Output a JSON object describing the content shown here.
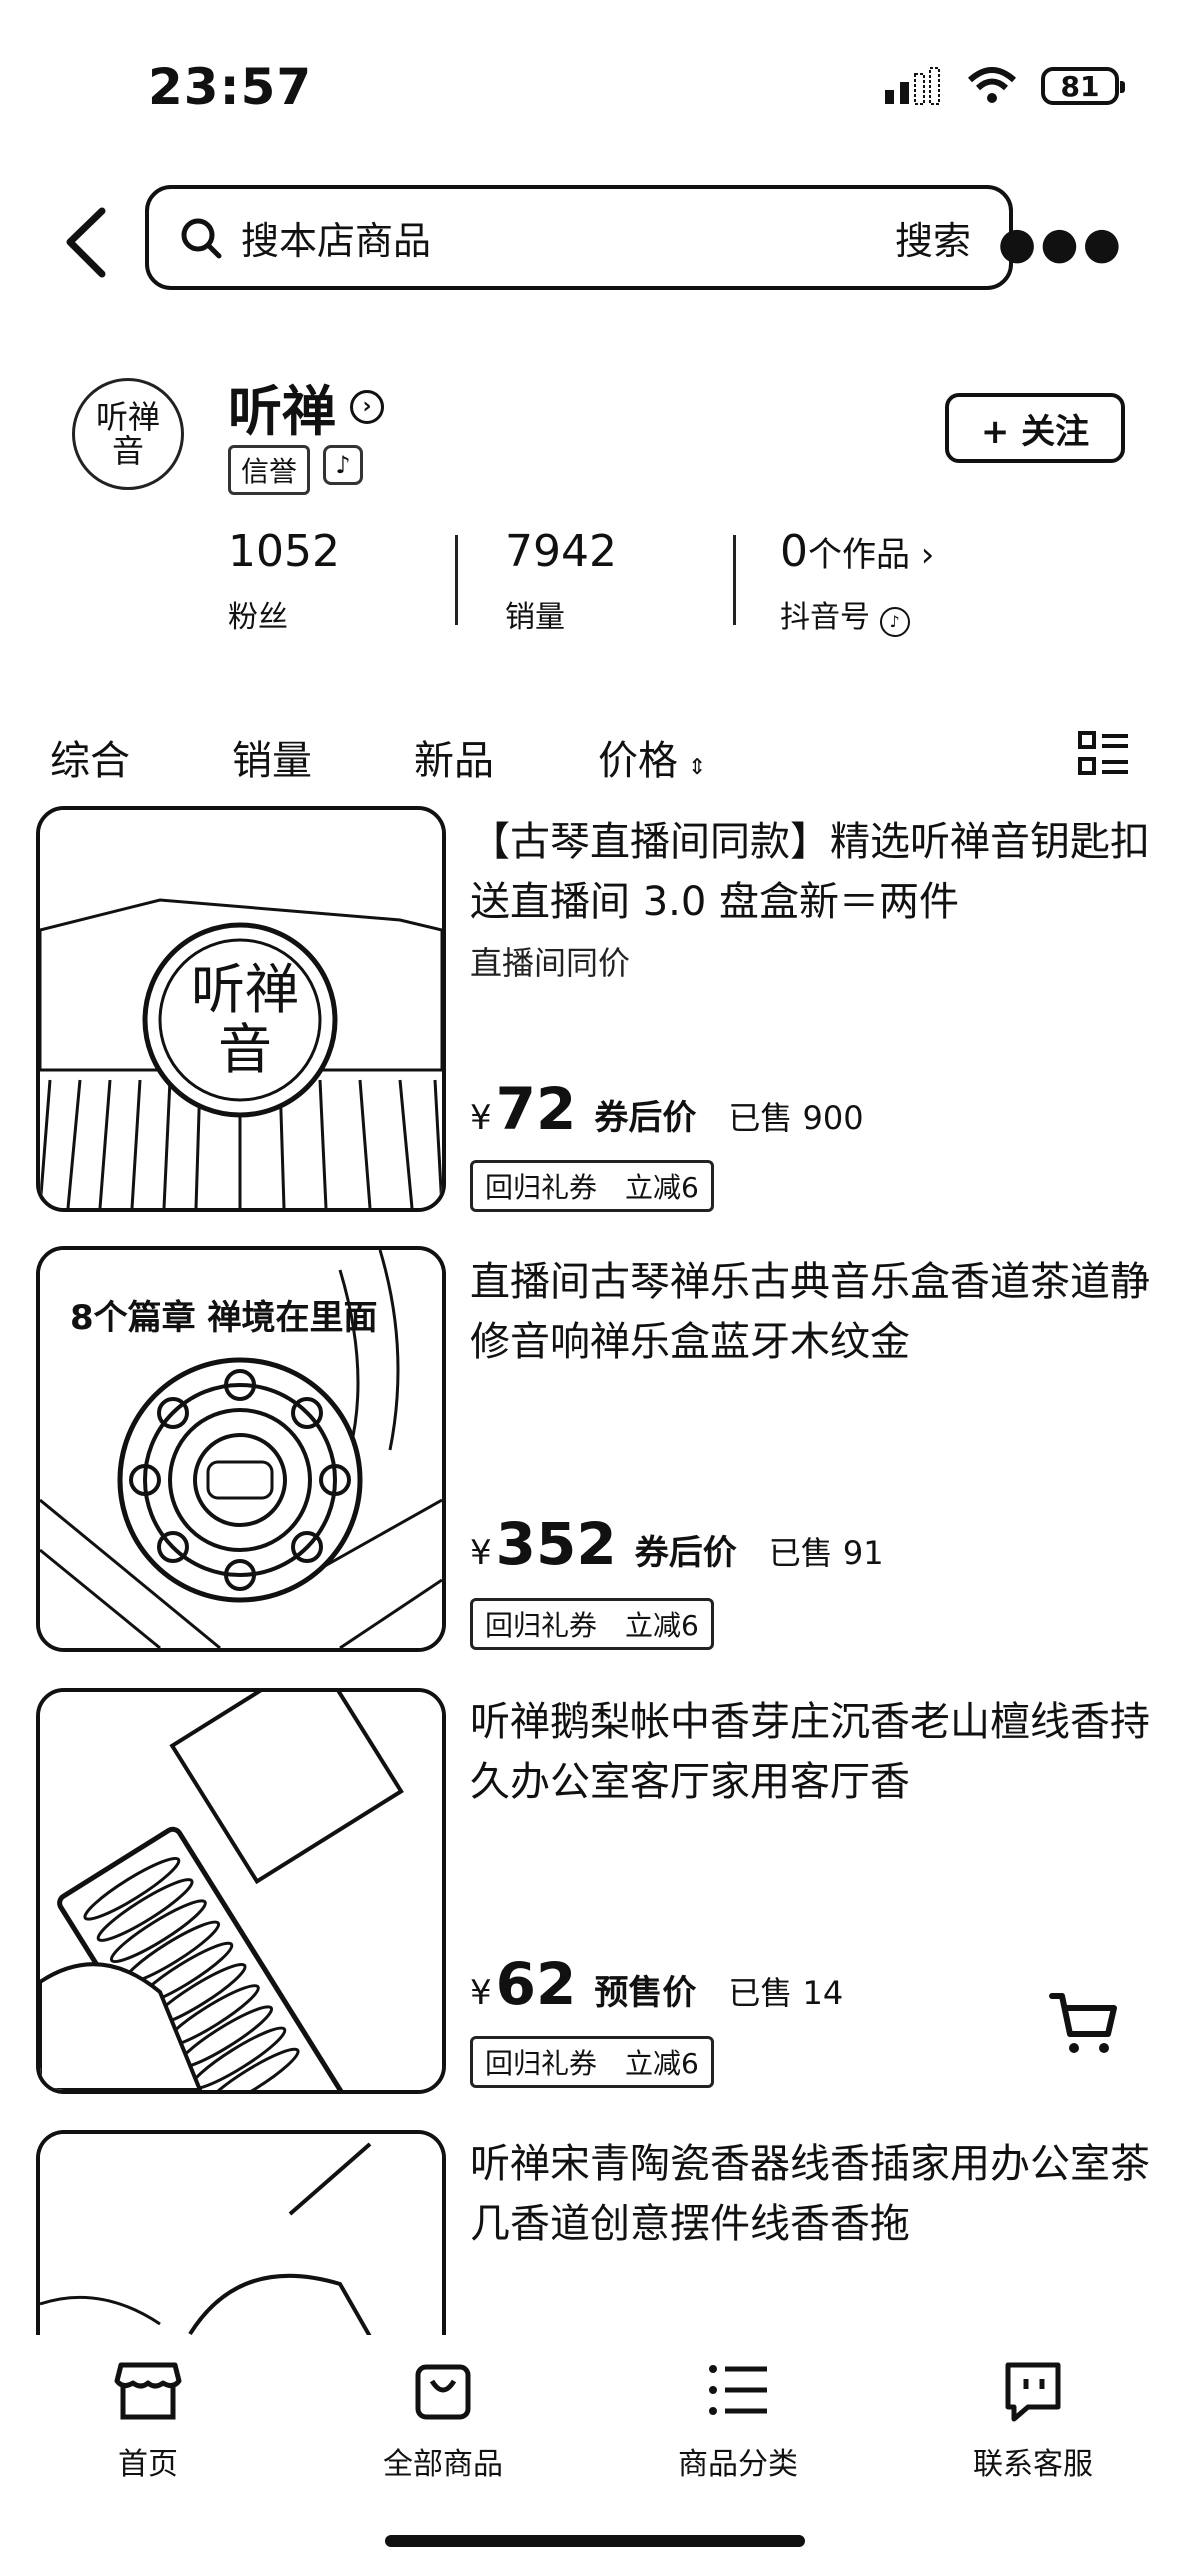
{
  "status_bar": {
    "time": "23:57",
    "battery": "81"
  },
  "search": {
    "placeholder": "搜本店商品",
    "button": "搜索"
  },
  "shop": {
    "name": "听禅",
    "logo_text": "听禅音",
    "badge": "信誉",
    "follow_label": "+ 关注",
    "stats": [
      {
        "value": "1052",
        "label": "粉丝"
      },
      {
        "value": "7942",
        "label": "销量"
      },
      {
        "value": "0",
        "value_suffix": "个作品 ›",
        "label": "抖音号"
      }
    ]
  },
  "tabs": [
    "综合",
    "销量",
    "新品",
    "价格"
  ],
  "products": [
    {
      "title": "【古琴直播间同款】精选听禅音钥匙扣送直播间 3.0 盘盒新＝两件",
      "subtitle": "直播间同价",
      "price": "72",
      "price_label": "券后价",
      "sold": "已售 900",
      "coupon_a": "回归礼券",
      "coupon_b": "立减6",
      "image_text": "听禅音"
    },
    {
      "title": "直播间古琴禅乐古典音乐盒香道茶道静修音响禅乐盒蓝牙木纹金",
      "subtitle": "",
      "price": "352",
      "price_label": "券后价",
      "sold": "已售 91",
      "coupon_a": "回归礼券",
      "coupon_b": "立减6",
      "image_text": "8个篇章 禅境在里面"
    },
    {
      "title": "听禅鹅梨帐中香芽庄沉香老山檀线香持久办公室客厅家用客厅香",
      "subtitle": "",
      "price": "62",
      "price_label": "预售价",
      "sold": "已售 14",
      "coupon_a": "回归礼券",
      "coupon_b": "立减6",
      "image_text": ""
    },
    {
      "title": "听禅宋青陶瓷香器线香插家用办公室茶几香道创意摆件线香香拖",
      "subtitle": "",
      "price": "",
      "price_label": "",
      "sold": "",
      "coupon_a": "",
      "coupon_b": "",
      "image_text": ""
    }
  ],
  "bottom_nav": [
    {
      "label": "首页",
      "icon": "shop-icon"
    },
    {
      "label": "全部商品",
      "icon": "bag-icon"
    },
    {
      "label": "商品分类",
      "icon": "list-icon"
    },
    {
      "label": "联系客服",
      "icon": "chat-icon"
    }
  ],
  "currency": "¥"
}
